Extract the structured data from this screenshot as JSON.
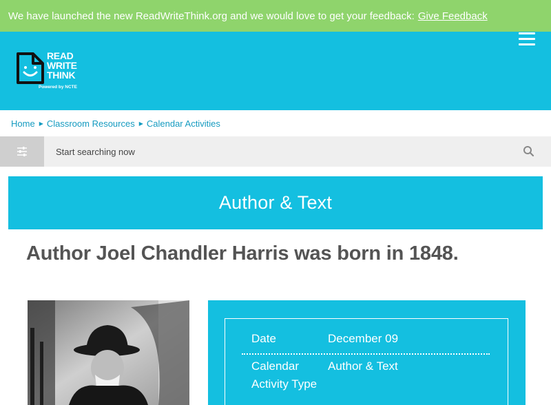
{
  "banner": {
    "message": "We have launched the new ReadWriteThink.org and we would love to get your feedback:",
    "link_label": "Give Feedback"
  },
  "header": {
    "logo": {
      "line1": "READ",
      "line2": "WRITE",
      "line3": "THINK",
      "tagline": "Powered by NCTE"
    },
    "menu_icon": "hamburger-icon"
  },
  "breadcrumb": [
    {
      "label": "Home"
    },
    {
      "label": "Classroom Resources"
    },
    {
      "label": "Calendar Activities"
    }
  ],
  "search": {
    "placeholder": "Start searching now",
    "filter_icon": "sliders-icon",
    "search_icon": "search-icon"
  },
  "section": {
    "title": "Author & Text"
  },
  "page": {
    "title": "Author Joel Chandler Harris was born in 1848."
  },
  "details": {
    "date_label": "Date",
    "date_value": "December 09",
    "type_label": "Calendar Activity Type",
    "type_value": "Author & Text"
  },
  "colors": {
    "banner_green": "#8fd46c",
    "brand_cyan": "#14bfe0",
    "link_blue": "#159bc0",
    "title_gray": "#545454"
  }
}
